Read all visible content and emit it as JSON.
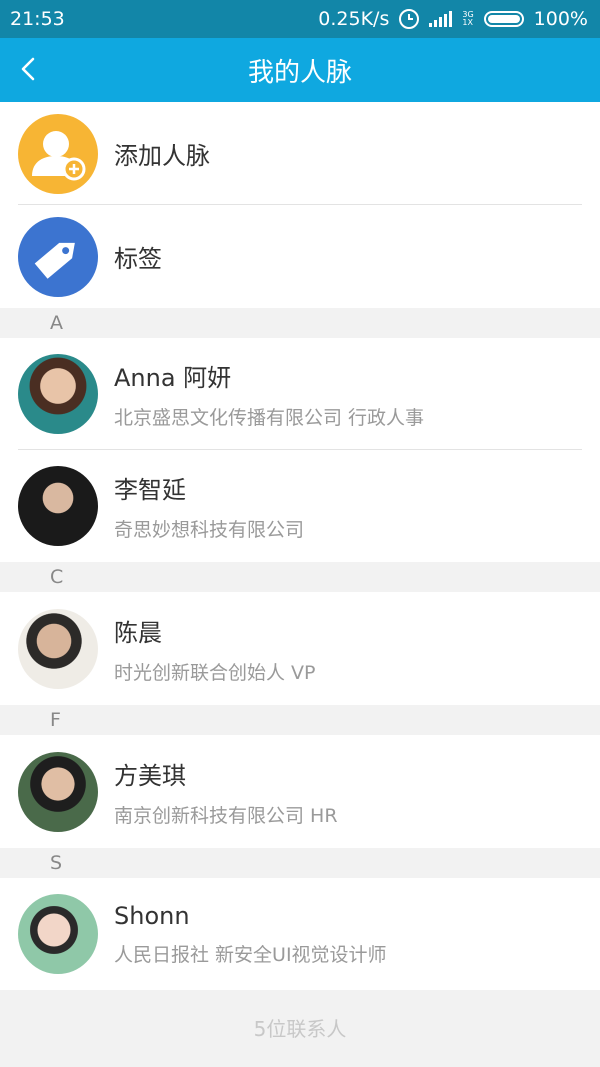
{
  "status_bar": {
    "time": "21:53",
    "net_speed": "0.25K/s",
    "signal_top": "3G",
    "signal_bottom": "1X",
    "battery": "100%"
  },
  "header": {
    "title": "我的人脉"
  },
  "actions": [
    {
      "label": "添加人脉",
      "icon": "add-contact-icon",
      "color": "#f7b534"
    },
    {
      "label": "标签",
      "icon": "tag-icon",
      "color": "#3c74d0"
    }
  ],
  "sections": [
    {
      "letter": "A",
      "contacts": [
        {
          "name": "Anna 阿妍",
          "detail": "北京盛思文化传播有限公司 行政人事"
        },
        {
          "name": "李智延",
          "detail": "奇思妙想科技有限公司"
        }
      ]
    },
    {
      "letter": "C",
      "contacts": [
        {
          "name": "陈晨",
          "detail": "时光创新联合创始人 VP"
        }
      ]
    },
    {
      "letter": "F",
      "contacts": [
        {
          "name": "方美琪",
          "detail": "南京创新科技有限公司 HR"
        }
      ]
    },
    {
      "letter": "S",
      "contacts": [
        {
          "name": "Shonn",
          "detail": "人民日报社 新安全UI视觉设计师"
        }
      ]
    }
  ],
  "footer": {
    "count_text": "5位联系人"
  },
  "colors": {
    "status_bar": "#1286a8",
    "app_bar": "#0fa8e0"
  }
}
